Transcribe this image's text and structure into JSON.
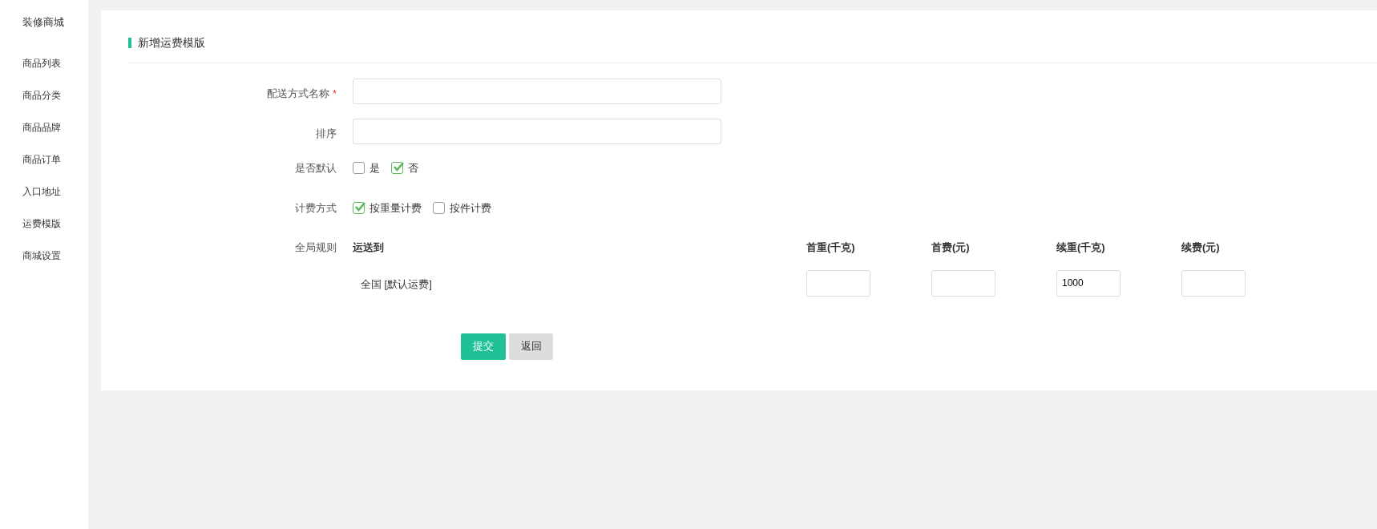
{
  "sidebar": {
    "brand": "装修商城",
    "items": [
      {
        "label": "商品列表"
      },
      {
        "label": "商品分类"
      },
      {
        "label": "商品品牌"
      },
      {
        "label": "商品订单"
      },
      {
        "label": "入口地址"
      },
      {
        "label": "运费模版"
      },
      {
        "label": "商城设置"
      }
    ]
  },
  "panel": {
    "title": "新增运费模版",
    "fields": [
      {
        "kind": "text",
        "label": "配送方式名称",
        "required_mark": "*"
      },
      {
        "kind": "text",
        "label": "排序"
      },
      {
        "kind": "checkboxes",
        "label": "是否默认",
        "options": [
          {
            "label": "是",
            "checked": false
          },
          {
            "label": "否",
            "checked": true
          }
        ]
      },
      {
        "kind": "checkboxes",
        "label": "计费方式",
        "options": [
          {
            "label": "按重量计费",
            "checked": true
          },
          {
            "label": "按件计费",
            "checked": false
          }
        ]
      },
      {
        "kind": "rules",
        "label": "全局规则",
        "columns": [
          "运送到",
          "首重(千克)",
          "首费(元)",
          "续重(千克)",
          "续费(元)"
        ],
        "rows": [
          {
            "cells": [
              {
                "kind": "text",
                "text": "全国 [默认运费]"
              },
              {
                "kind": "input"
              },
              {
                "kind": "input"
              },
              {
                "kind": "input",
                "value": "1000"
              },
              {
                "kind": "input"
              }
            ]
          }
        ]
      }
    ],
    "buttons": [
      {
        "label": "提交",
        "kind": "primary"
      },
      {
        "label": "返回",
        "kind": "secondary"
      }
    ]
  }
}
